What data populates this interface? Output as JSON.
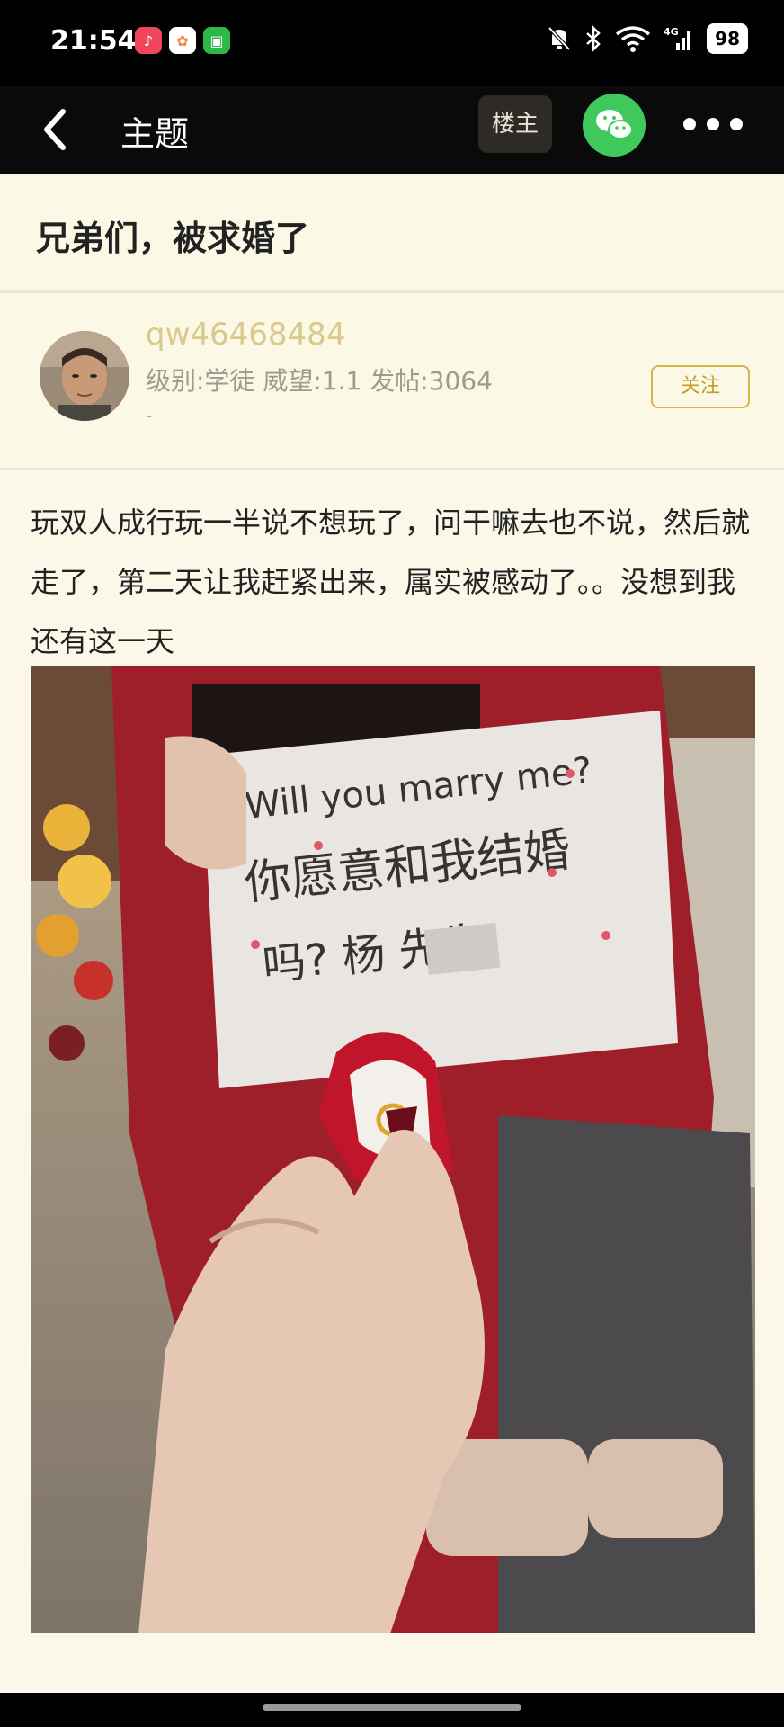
{
  "status_bar": {
    "time": "21:54",
    "battery": "98",
    "network": "4G",
    "icons": [
      "music-app-icon",
      "gallery-app-icon",
      "wechat-work-icon",
      "mute-bell-icon",
      "bluetooth-icon",
      "wifi-icon",
      "signal-icon"
    ]
  },
  "nav": {
    "title": "主题",
    "louzhu_label": "楼主",
    "icons": [
      "back-arrow-icon",
      "wechat-share-icon",
      "more-icon"
    ]
  },
  "post": {
    "title": "兄弟们，被求婚了",
    "body": "玩双人成行玩一半说不想玩了，问干嘛去也不说，然后就走了，第二天让我赶紧出来，属实被感动了。。没想到我还有这一天"
  },
  "author": {
    "username": "qw46468484",
    "meta": "级别:学徒 威望:1.1 发帖:3064",
    "extra": "-",
    "follow_label": "关注"
  },
  "photo": {
    "sign_line1": "Will you marry me?",
    "sign_line2": "你愿意和我结婚",
    "sign_line3": "吗? 杨    先生!"
  },
  "colors": {
    "background": "#fbf8ea",
    "bar": "#000000",
    "accent": "#d9b44a",
    "username": "#d9c98d",
    "wechat": "#3fc95d"
  }
}
